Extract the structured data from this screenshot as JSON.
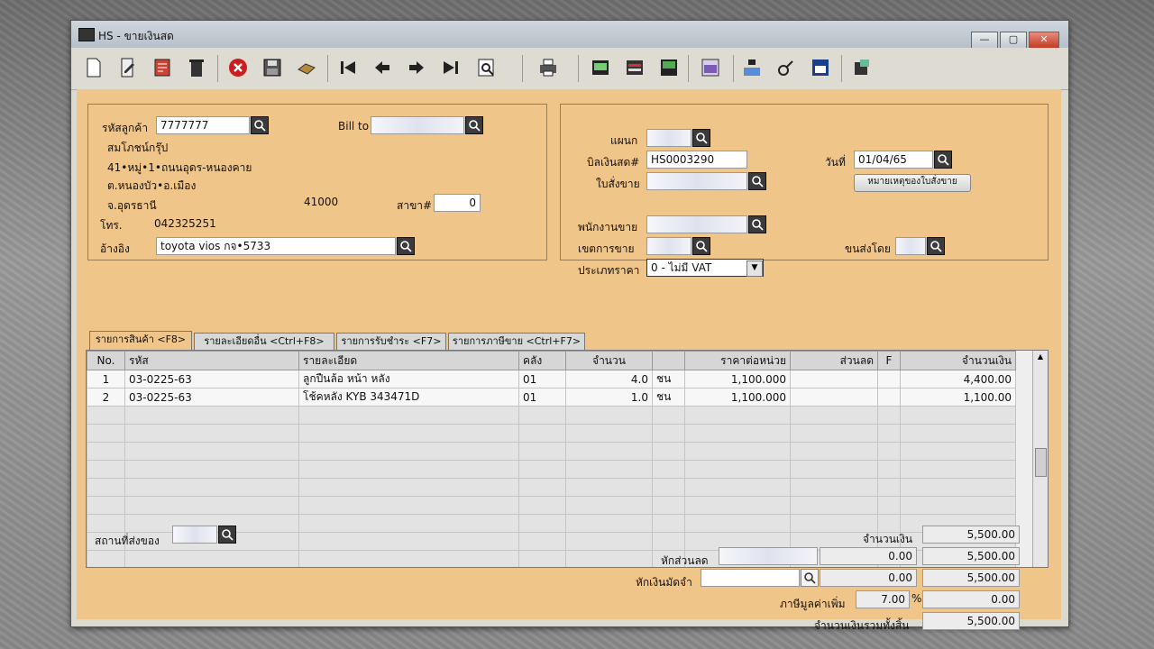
{
  "window": {
    "title": "HS - ขายเงินสด",
    "min": "—",
    "max": "▢",
    "close": "✕"
  },
  "customer": {
    "code_label": "รหัสลูกค้า",
    "code": "7777777",
    "billto_label": "Bill to",
    "name": "สมโภชน์กรุ๊ป",
    "addr1": "41•หมู่•1•ถนนอุดร-หนองคาย",
    "addr2": "ต.หนองบัว•อ.เมือง",
    "addr3": "จ.อุดรธานี",
    "zip": "41000",
    "branch_label": "สาขา#",
    "branch": "0",
    "phone_label": "โทร.",
    "phone": "042325251",
    "ref_label": "อ้างอิง",
    "ref": "toyota vios กจ•5733"
  },
  "doc": {
    "dept_label": "แผนก",
    "bill_label": "บิลเงินสด#",
    "bill": "HS0003290",
    "date_label": "วันที่",
    "date": "01/04/65",
    "order_label": "ใบสั่งขาย",
    "order_note_button": "หมายเหตุของใบสั่งขาย",
    "salesman_label": "พนักงานขาย",
    "area_label": "เขตการขาย",
    "ship_label": "ขนส่งโดย",
    "price_type_label": "ประเภทราคา",
    "price_type": "0 - ไม่มี VAT"
  },
  "tabs": [
    "รายการสินค้า <F8>",
    "รายละเอียดอื่น <Ctrl+F8>",
    "รายการรับชำระ <F7>",
    "รายการภาษีขาย <Ctrl+F7>"
  ],
  "table": {
    "headers": [
      "No.",
      "รหัส",
      "รายละเอียด",
      "คลัง",
      "จำนวน",
      "",
      "ราคาต่อหน่วย",
      "ส่วนลด",
      "F",
      "จำนวนเงิน"
    ],
    "rows": [
      [
        "1",
        "03-0225-63",
        "ลูกปืนล้อ หน้า หลัง",
        "01",
        "4.0",
        "ชน",
        "1,100.000",
        "",
        "",
        "4,400.00"
      ],
      [
        "2",
        "03-0225-63",
        "โช้คหลัง KYB 343471D",
        "01",
        "1.0",
        "ชน",
        "1,100.000",
        "",
        "",
        "1,100.00"
      ]
    ]
  },
  "footer": {
    "delivery_label": "สถานที่ส่งของ",
    "amount_label": "จำนวนเงิน",
    "amount": "5,500.00",
    "discount_label": "หักส่วนลด",
    "discount": "0.00",
    "after_discount": "5,500.00",
    "deposit_label": "หักเงินมัดจำ",
    "deposit": "0.00",
    "after_deposit": "5,500.00",
    "vat_label": "ภาษีมูลค่าเพิ่ม",
    "vat_rate": "7.00",
    "vat_pct": "%",
    "vat_amount": "0.00",
    "total_label": "จำนวนเงินรวมทั้งสิ้น",
    "total": "5,500.00"
  },
  "icons": [
    "new-icon",
    "edit-icon",
    "print-form-icon",
    "delete-icon",
    "cancel-icon",
    "save-icon",
    "approve-icon",
    "first-icon",
    "prev-icon",
    "next-icon",
    "last-icon",
    "search-icon",
    "printer-icon",
    "report-icon",
    "tape-icon",
    "data-icon",
    "calc-icon",
    "ok-icon",
    "key-icon",
    "ok2-icon",
    "db-icon"
  ]
}
